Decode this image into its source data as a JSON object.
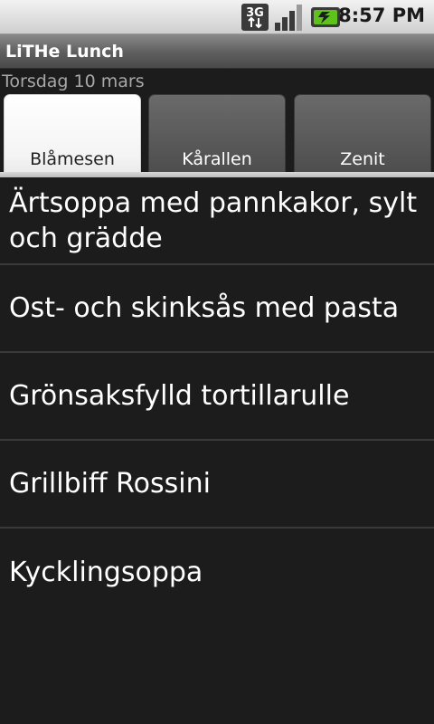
{
  "status_bar": {
    "network_icon": "3g-icon",
    "signal_icon": "signal-strength-icon",
    "battery_icon": "battery-charging-icon",
    "time": "8:57 PM"
  },
  "app": {
    "title": "LiTHe Lunch"
  },
  "date": "Torsdag 10 mars",
  "tabs": [
    {
      "label": "Blåmesen",
      "selected": true
    },
    {
      "label": "Kårallen",
      "selected": false
    },
    {
      "label": "Zenit",
      "selected": false
    }
  ],
  "menu": [
    "Ärtsoppa med pannkakor, sylt och grädde",
    "Ost- och skinksås med pasta",
    "Grönsaksfylld tortillarulle",
    "Grillbiff Rossini",
    "Kycklingsoppa"
  ],
  "colors": {
    "background": "#1c1c1c",
    "battery_accent": "#5fc21c"
  }
}
